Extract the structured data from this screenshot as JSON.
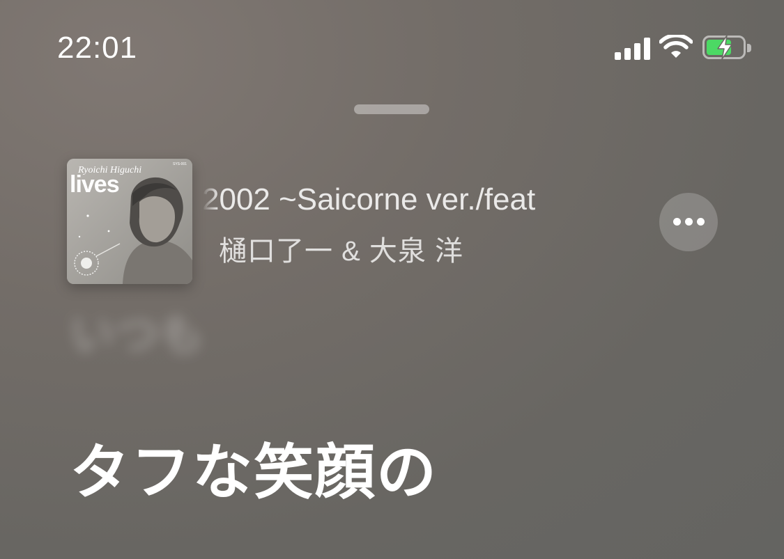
{
  "status_bar": {
    "time": "22:01",
    "icons": [
      "cellular-signal-icon",
      "wifi-icon",
      "battery-charging-icon"
    ],
    "battery_level": 0.7,
    "battery_color": "#4cd964"
  },
  "now_playing": {
    "album_art": {
      "artist_text": "Ryoichi Higuchi",
      "title_text": "lives",
      "catalog_text": "SYS-001"
    },
    "title": "2002 ~Saicorne ver./feat",
    "artist": "樋口了一 & 大泉 洋",
    "more_icon": "ellipsis-icon"
  },
  "lyrics": {
    "previous_line": "いつも",
    "current_line": "タフな笑顔の"
  }
}
